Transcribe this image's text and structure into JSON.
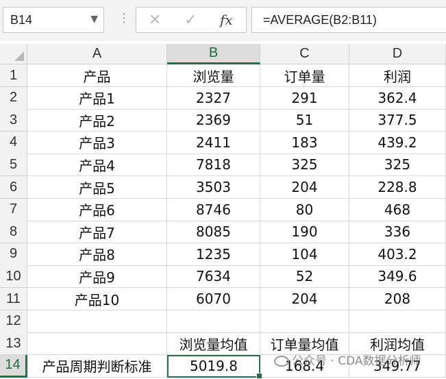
{
  "formula_bar": {
    "name_box": "B14",
    "formula": "=AVERAGE(B2:B11)",
    "fx_label": "fx"
  },
  "columns": [
    "A",
    "B",
    "C",
    "D"
  ],
  "selected_column": "B",
  "selected_row": "14",
  "rows": [
    {
      "n": "1",
      "cells": [
        "产品",
        "浏览量",
        "订单量",
        "利润"
      ]
    },
    {
      "n": "2",
      "cells": [
        "产品1",
        "2327",
        "291",
        "362.4"
      ]
    },
    {
      "n": "3",
      "cells": [
        "产品2",
        "2369",
        "51",
        "377.5"
      ]
    },
    {
      "n": "4",
      "cells": [
        "产品3",
        "2411",
        "183",
        "439.2"
      ]
    },
    {
      "n": "5",
      "cells": [
        "产品4",
        "7818",
        "325",
        "325"
      ]
    },
    {
      "n": "6",
      "cells": [
        "产品5",
        "3503",
        "204",
        "228.8"
      ]
    },
    {
      "n": "7",
      "cells": [
        "产品6",
        "8746",
        "80",
        "468"
      ]
    },
    {
      "n": "8",
      "cells": [
        "产品7",
        "8085",
        "190",
        "336"
      ]
    },
    {
      "n": "9",
      "cells": [
        "产品8",
        "1235",
        "104",
        "403.2"
      ]
    },
    {
      "n": "10",
      "cells": [
        "产品9",
        "7634",
        "52",
        "349.6"
      ]
    },
    {
      "n": "11",
      "cells": [
        "产品10",
        "6070",
        "204",
        "208"
      ]
    },
    {
      "n": "12",
      "cells": [
        "",
        "",
        "",
        ""
      ]
    },
    {
      "n": "13",
      "cells": [
        "",
        "浏览量均值",
        "订单量均值",
        "利润均值"
      ]
    },
    {
      "n": "14",
      "cells": [
        "产品周期判断标准",
        "5019.8",
        "168.4",
        "349.77"
      ]
    }
  ],
  "watermark": "公众号 · CDA数据分析师",
  "colors": {
    "accent": "#217346"
  }
}
